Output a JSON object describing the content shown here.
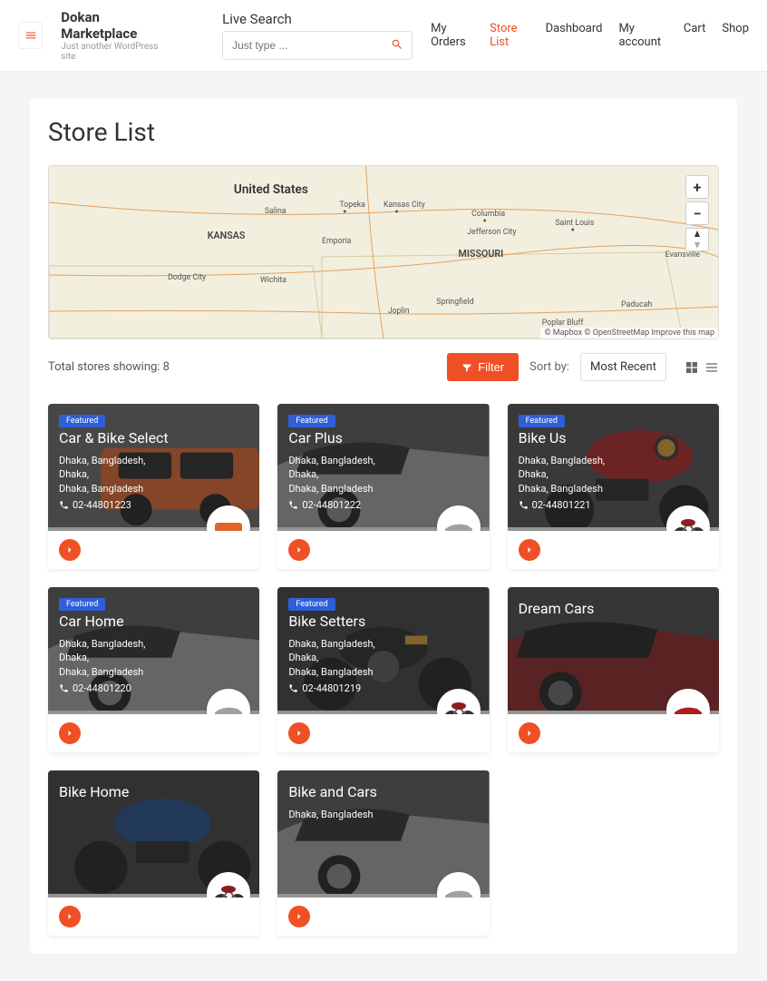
{
  "header": {
    "brand_title": "Dokan Marketplace",
    "brand_sub": "Just another WordPress site",
    "search_label": "Live Search",
    "search_placeholder": "Just type ...",
    "nav": [
      {
        "label": "My Orders",
        "active": false
      },
      {
        "label": "Store List",
        "active": true
      },
      {
        "label": "Dashboard",
        "active": false
      },
      {
        "label": "My account",
        "active": false
      },
      {
        "label": "Cart",
        "active": false
      },
      {
        "label": "Shop",
        "active": false
      }
    ]
  },
  "page_title": "Store List",
  "map": {
    "labels": [
      "United States",
      "KANSAS",
      "MISSOURI",
      "Topeka",
      "Kansas City",
      "Columbia",
      "Saint Louis",
      "Salina",
      "Jefferson City",
      "Emporia",
      "Dodge City",
      "Wichita",
      "Springfield",
      "Joplin",
      "Poplar Bluff",
      "Paducah",
      "Evansville"
    ],
    "attribution": "© Mapbox © OpenStreetMap Improve this map"
  },
  "toolbar": {
    "total": "Total stores showing: 8",
    "filter_label": "Filter",
    "sort_label": "Sort by:",
    "sort_value": "Most Recent"
  },
  "stores": [
    {
      "name": "Car & Bike Select",
      "featured": true,
      "addr1": "Dhaka, Bangladesh,",
      "addr2": "Dhaka,",
      "addr3": "Dhaka, Bangladesh",
      "phone": "02-44801223",
      "bg": "suv-orange"
    },
    {
      "name": "Car Plus",
      "featured": true,
      "addr1": "Dhaka, Bangladesh,",
      "addr2": "Dhaka,",
      "addr3": "Dhaka, Bangladesh",
      "phone": "02-44801222",
      "bg": "sedan-grey"
    },
    {
      "name": "Bike Us",
      "featured": true,
      "addr1": "Dhaka, Bangladesh,",
      "addr2": "Dhaka,",
      "addr3": "Dhaka, Bangladesh",
      "phone": "02-44801221",
      "bg": "bike-red"
    },
    {
      "name": "Car Home",
      "featured": true,
      "addr1": "Dhaka, Bangladesh,",
      "addr2": "Dhaka,",
      "addr3": "Dhaka, Bangladesh",
      "phone": "02-44801220",
      "bg": "sedan-grey"
    },
    {
      "name": "Bike Setters",
      "featured": true,
      "addr1": "Dhaka, Bangladesh,",
      "addr2": "Dhaka,",
      "addr3": "Dhaka, Bangladesh",
      "phone": "02-44801219",
      "bg": "bike-black"
    },
    {
      "name": "Dream Cars",
      "featured": false,
      "addr1": "",
      "addr2": "",
      "addr3": "",
      "phone": "",
      "bg": "sedan-red"
    },
    {
      "name": "Bike Home",
      "featured": false,
      "addr1": "",
      "addr2": "",
      "addr3": "",
      "phone": "",
      "bg": "bike-blue"
    },
    {
      "name": "Bike and Cars",
      "featured": false,
      "addr1": "Dhaka, Bangladesh",
      "addr2": "",
      "addr3": "",
      "phone": "",
      "bg": "sedan-grey2"
    }
  ],
  "featured_label": "Featured"
}
